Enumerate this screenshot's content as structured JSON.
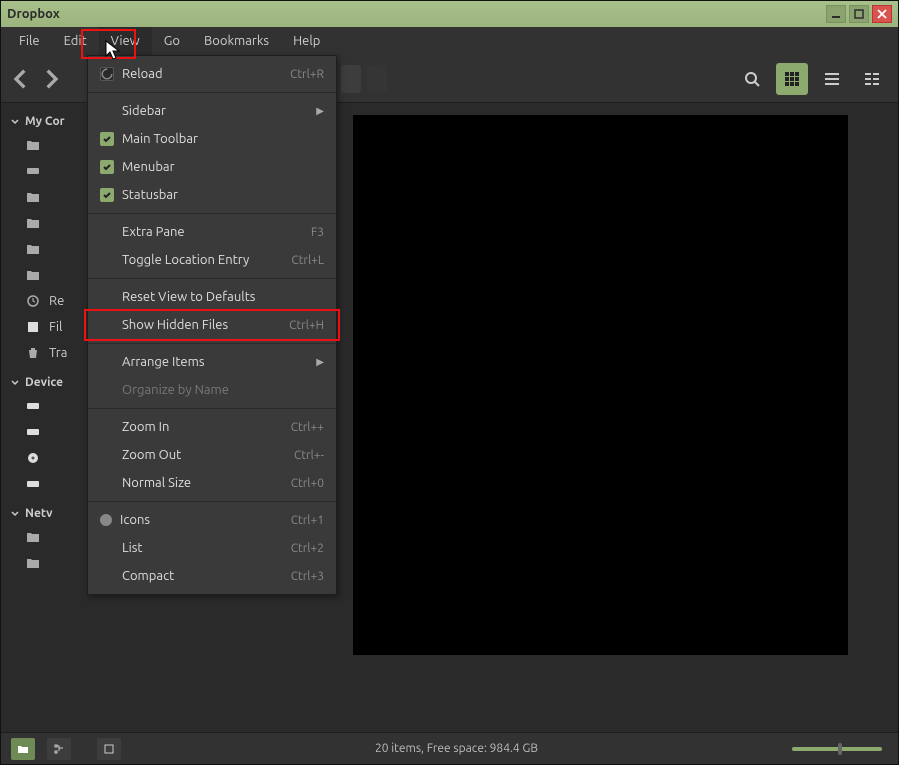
{
  "window": {
    "title": "Dropbox"
  },
  "menubar": {
    "items": [
      "File",
      "Edit",
      "View",
      "Go",
      "Bookmarks",
      "Help"
    ],
    "active_index": 2
  },
  "toolbar": {
    "path_crumbs": [
      ""
    ],
    "path_crumbs_ghost": [
      ""
    ]
  },
  "dropdown": {
    "reload": {
      "label": "Reload",
      "key": "Ctrl+R"
    },
    "sidebar": {
      "label": "Sidebar"
    },
    "main_toolbar": {
      "label": "Main Toolbar"
    },
    "menubar": {
      "label": "Menubar"
    },
    "statusbar": {
      "label": "Statusbar"
    },
    "extra_pane": {
      "label": "Extra Pane",
      "key": "F3"
    },
    "toggle_location": {
      "label": "Toggle Location Entry",
      "key": "Ctrl+L"
    },
    "reset_view": {
      "label": "Reset View to Defaults"
    },
    "show_hidden": {
      "label": "Show Hidden Files",
      "key": "Ctrl+H"
    },
    "arrange": {
      "label": "Arrange Items"
    },
    "organize": {
      "label": "Organize by Name"
    },
    "zoom_in": {
      "label": "Zoom In",
      "key": "Ctrl++"
    },
    "zoom_out": {
      "label": "Zoom Out",
      "key": "Ctrl+-"
    },
    "normal_size": {
      "label": "Normal Size",
      "key": "Ctrl+0"
    },
    "icons": {
      "label": "Icons",
      "key": "Ctrl+1"
    },
    "list": {
      "label": "List",
      "key": "Ctrl+2"
    },
    "compact": {
      "label": "Compact",
      "key": "Ctrl+3"
    }
  },
  "sidebar": {
    "sections": {
      "computer": {
        "header": "My Cor",
        "items": [
          "",
          "",
          "",
          "",
          "",
          "",
          "Re",
          "Fil",
          "Tra"
        ]
      },
      "devices": {
        "header": "Device",
        "items": [
          "",
          "",
          "",
          ""
        ]
      },
      "network": {
        "header": "Netv",
        "items": [
          "",
          ""
        ]
      }
    }
  },
  "statusbar": {
    "text": "20 items, Free space: 984.4 GB"
  }
}
